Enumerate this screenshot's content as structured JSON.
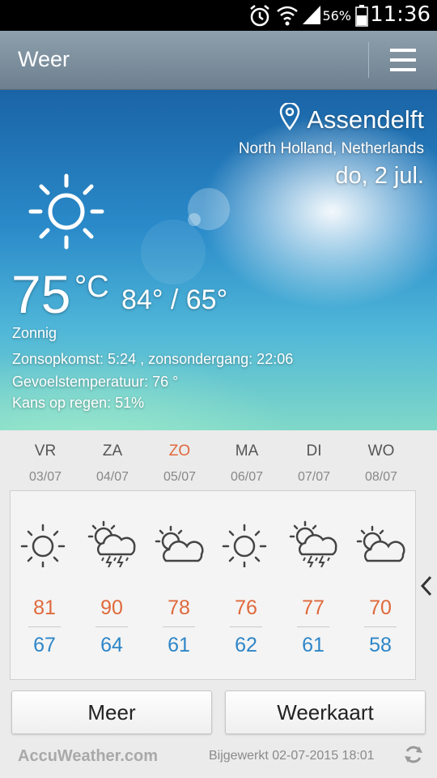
{
  "status_bar": {
    "battery_percent": "56%",
    "time": "11:36",
    "icons": [
      "alarm-icon",
      "wifi-icon",
      "signal-icon",
      "battery-icon"
    ]
  },
  "app_bar": {
    "title": "Weer",
    "menu_icon": "menu-icon"
  },
  "current": {
    "location": "Assendelft",
    "region": "North Holland, Netherlands",
    "date": "do, 2 jul.",
    "temperature": "75",
    "unit": "°C",
    "high_low": "84° / 65°",
    "condition": "Zonnig",
    "sun_times": "Zonsopkomst: 5:24 , zonsondergang: 22:06",
    "feels_like": "Gevoelstemperatuur: 76 °",
    "rain_chance": "Kans op regen: 51%",
    "condition_icon": "sun-icon"
  },
  "forecast": [
    {
      "day": "VR",
      "date": "03/07",
      "high": "81",
      "low": "67",
      "icon": "sun"
    },
    {
      "day": "ZA",
      "date": "04/07",
      "high": "90",
      "low": "64",
      "icon": "thunderstorm"
    },
    {
      "day": "ZO",
      "date": "05/07",
      "high": "78",
      "low": "61",
      "icon": "partly-cloudy"
    },
    {
      "day": "MA",
      "date": "06/07",
      "high": "76",
      "low": "62",
      "icon": "sun"
    },
    {
      "day": "DI",
      "date": "07/07",
      "high": "77",
      "low": "61",
      "icon": "thunderstorm"
    },
    {
      "day": "WO",
      "date": "08/07",
      "high": "70",
      "low": "58",
      "icon": "partly-cloudy"
    }
  ],
  "buttons": {
    "more": "Meer",
    "map": "Weerkaart"
  },
  "footer": {
    "brand": "AccuWeather.com",
    "updated": "Bijgewerkt 02-07-2015 18:01"
  },
  "colors": {
    "high": "#e0693c",
    "low": "#2e86c8",
    "sunday": "#e0693c"
  }
}
